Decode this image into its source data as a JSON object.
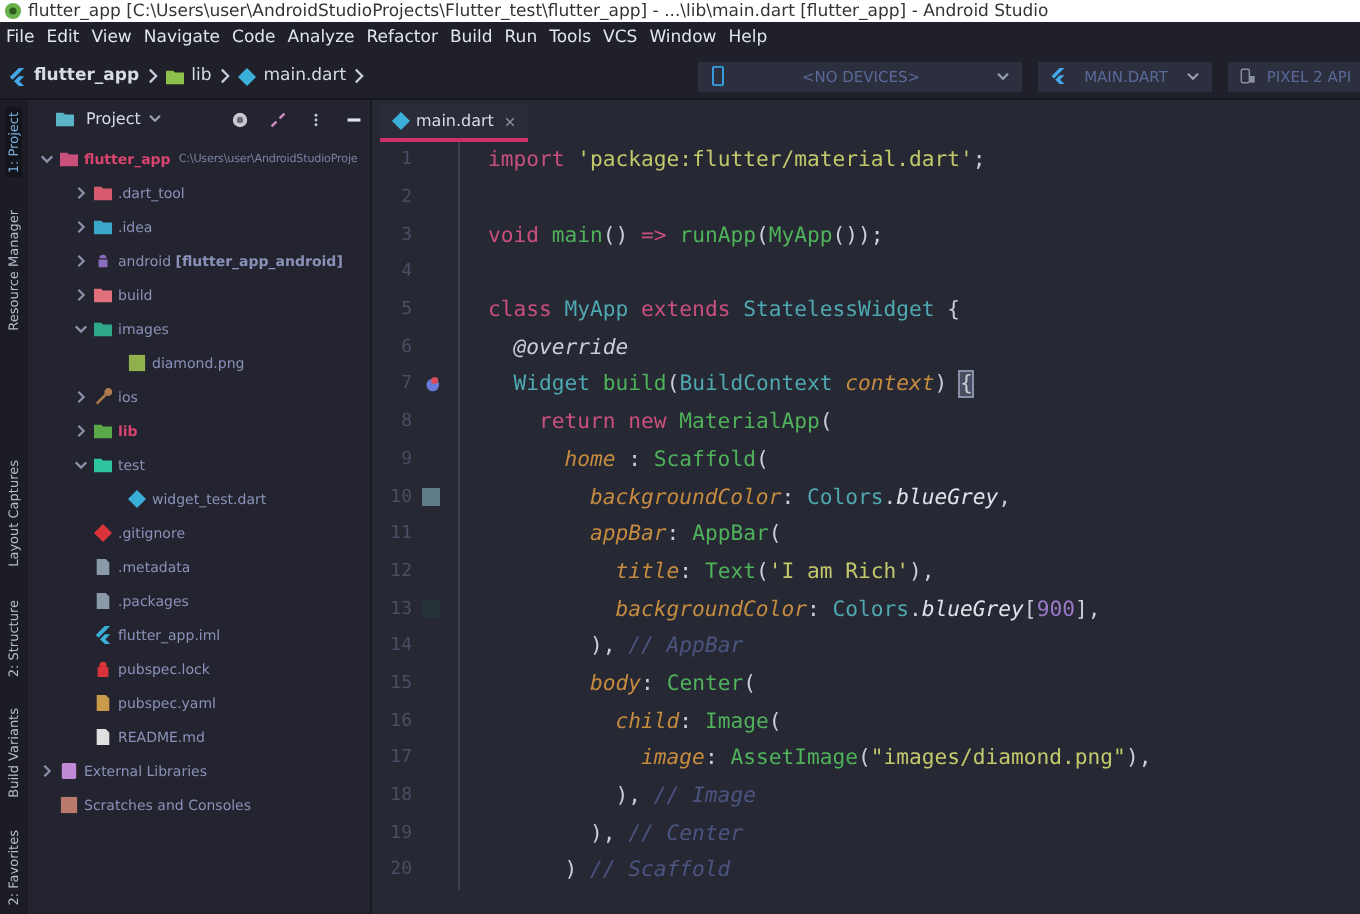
{
  "window": {
    "title": "flutter_app [C:\\Users\\user\\AndroidStudioProjects\\Flutter_test\\flutter_app] - ...\\lib\\main.dart [flutter_app] - Android Studio"
  },
  "menu": [
    "File",
    "Edit",
    "View",
    "Navigate",
    "Code",
    "Analyze",
    "Refactor",
    "Build",
    "Run",
    "Tools",
    "VCS",
    "Window",
    "Help"
  ],
  "breadcrumbs": [
    {
      "label": "flutter_app",
      "kind": "flutter"
    },
    {
      "label": "lib",
      "kind": "folder"
    },
    {
      "label": "main.dart",
      "kind": "dart"
    }
  ],
  "run_toolbar": [
    {
      "label": "<NO DEVICES>",
      "kind": "device"
    },
    {
      "label": "MAIN.DART",
      "kind": "config"
    },
    {
      "label": "PIXEL 2 API",
      "kind": "avd"
    }
  ],
  "tool_strip_top": [
    {
      "label": "1: Project",
      "selected": true
    },
    {
      "label": "Resource Manager",
      "selected": false
    }
  ],
  "tool_strip_bottom": [
    {
      "label": "Layout Captures",
      "selected": false
    },
    {
      "label": "2: Structure",
      "selected": false
    },
    {
      "label": "Build Variants",
      "selected": false
    },
    {
      "label": "2: Favorites",
      "selected": false
    }
  ],
  "project": {
    "title": "Project",
    "tree": [
      {
        "label": "flutter_app",
        "path": "C:\\Users\\user\\AndroidStudioProje",
        "kind": "module",
        "color": "#c8507a",
        "accent": true,
        "expanded": true,
        "children": [
          {
            "label": ".dart_tool",
            "kind": "folder",
            "color": "#d75a6e",
            "expanded": false
          },
          {
            "label": ".idea",
            "kind": "folder",
            "color": "#3aa6c8",
            "expanded": false
          },
          {
            "label": "android **[flutter_app_android]**",
            "kind": "android",
            "color": "#8a6bbd",
            "expanded": false
          },
          {
            "label": "build",
            "kind": "folder",
            "color": "#e0707a",
            "expanded": false
          },
          {
            "label": "images",
            "kind": "folder",
            "color": "#2fa88a",
            "expanded": true,
            "children": [
              {
                "label": "diamond.png",
                "kind": "image",
                "color": "#8fb04a"
              }
            ]
          },
          {
            "label": "ios",
            "kind": "wrench",
            "color": "#b07a4a",
            "expanded": false
          },
          {
            "label": "lib",
            "kind": "folder",
            "color": "#5aa84a",
            "accent": true,
            "expanded": false
          },
          {
            "label": "test",
            "kind": "folder",
            "color": "#2fc4a0",
            "expanded": true,
            "children": [
              {
                "label": "widget_test.dart",
                "kind": "dart",
                "color": "#3ab0d8"
              }
            ]
          },
          {
            "label": ".gitignore",
            "kind": "diamond",
            "color": "#d8343a"
          },
          {
            "label": ".metadata",
            "kind": "file",
            "color": "#8a9aa8"
          },
          {
            "label": ".packages",
            "kind": "file",
            "color": "#8a9aa8"
          },
          {
            "label": "flutter_app.iml",
            "kind": "flutter",
            "color": "#3ab0d8"
          },
          {
            "label": "pubspec.lock",
            "kind": "lock",
            "color": "#d8343a"
          },
          {
            "label": "pubspec.yaml",
            "kind": "file",
            "color": "#c89a4a"
          },
          {
            "label": "README.md",
            "kind": "file",
            "color": "#e0e0e0"
          }
        ]
      },
      {
        "label": "External Libraries",
        "kind": "library",
        "color": "#c08ad8",
        "expanded": false
      },
      {
        "label": "Scratches and Consoles",
        "kind": "scratch",
        "color": "#b87a6a"
      }
    ]
  },
  "editor": {
    "tab": {
      "label": "main.dart",
      "selected": true
    },
    "lines": [
      {
        "number": "1",
        "tokens": [
          {
            "kind": "keyword",
            "text": "import"
          },
          {
            "kind": "string",
            "text": " 'package:flutter/material.dart'"
          },
          {
            "kind": "plain",
            "text": ";"
          }
        ]
      },
      {
        "number": "2"
      },
      {
        "number": "3",
        "tokens": [
          {
            "kind": "keyword",
            "text": "void"
          },
          {
            "kind": "function",
            "text": " main"
          },
          {
            "kind": "plain",
            "text": "() "
          },
          {
            "kind": "keyword",
            "text": "=>"
          },
          {
            "kind": "function",
            "text": " runApp"
          },
          {
            "kind": "plain",
            "text": "("
          },
          {
            "kind": "function",
            "text": "MyApp"
          },
          {
            "kind": "plain",
            "text": "());"
          }
        ]
      },
      {
        "number": "4"
      },
      {
        "number": "5",
        "tokens": [
          {
            "kind": "keyword",
            "text": "class"
          },
          {
            "kind": "type",
            "text": " MyApp"
          },
          {
            "kind": "keyword",
            "text": " extends"
          },
          {
            "kind": "type",
            "text": " StatelessWidget"
          },
          {
            "kind": "plain",
            "text": " {"
          }
        ]
      },
      {
        "number": "6",
        "tokens": [
          {
            "kind": "annotation",
            "text": "  @override"
          }
        ]
      },
      {
        "number": "7",
        "gutter": {
          "kind": "override"
        },
        "tokens": [
          {
            "kind": "type",
            "text": "  Widget"
          },
          {
            "kind": "function",
            "text": " build"
          },
          {
            "kind": "plain",
            "text": "("
          },
          {
            "kind": "type",
            "text": "BuildContext"
          },
          {
            "kind": "param",
            "text": " context"
          },
          {
            "kind": "plain",
            "text": ") "
          },
          {
            "kind": "match",
            "text": "{"
          }
        ]
      },
      {
        "number": "8",
        "tokens": [
          {
            "kind": "keyword",
            "text": "    return"
          },
          {
            "kind": "keyword",
            "text": " new"
          },
          {
            "kind": "function",
            "text": " MaterialApp"
          },
          {
            "kind": "plain",
            "text": "("
          }
        ]
      },
      {
        "number": "9",
        "tokens": [
          {
            "kind": "property",
            "text": "      home"
          },
          {
            "kind": "plain",
            "text": " : "
          },
          {
            "kind": "function",
            "text": "Scaffold"
          },
          {
            "kind": "plain",
            "text": "("
          }
        ]
      },
      {
        "number": "10",
        "gutter": {
          "kind": "swatch",
          "color": "#607d8b"
        },
        "tokens": [
          {
            "kind": "property",
            "text": "        backgroundColor"
          },
          {
            "kind": "plain",
            "text": ": "
          },
          {
            "kind": "type",
            "text": "Colors"
          },
          {
            "kind": "plain",
            "text": "."
          },
          {
            "kind": "italic",
            "text": "blueGrey"
          },
          {
            "kind": "plain",
            "text": ","
          }
        ]
      },
      {
        "number": "11",
        "tokens": [
          {
            "kind": "property",
            "text": "        appBar"
          },
          {
            "kind": "plain",
            "text": ": "
          },
          {
            "kind": "function",
            "text": "AppBar"
          },
          {
            "kind": "plain",
            "text": "("
          }
        ]
      },
      {
        "number": "12",
        "tokens": [
          {
            "kind": "property",
            "text": "          title"
          },
          {
            "kind": "plain",
            "text": ": "
          },
          {
            "kind": "function",
            "text": "Text"
          },
          {
            "kind": "plain",
            "text": "("
          },
          {
            "kind": "string",
            "text": "'I am Rich'"
          },
          {
            "kind": "plain",
            "text": "),"
          }
        ]
      },
      {
        "number": "13",
        "gutter": {
          "kind": "swatch",
          "color": "#263238"
        },
        "tokens": [
          {
            "kind": "property",
            "text": "          backgroundColor"
          },
          {
            "kind": "plain",
            "text": ": "
          },
          {
            "kind": "type",
            "text": "Colors"
          },
          {
            "kind": "plain",
            "text": "."
          },
          {
            "kind": "italic",
            "text": "blueGrey"
          },
          {
            "kind": "plain",
            "text": "["
          },
          {
            "kind": "number",
            "text": "900"
          },
          {
            "kind": "plain",
            "text": "],"
          }
        ]
      },
      {
        "number": "14",
        "tokens": [
          {
            "kind": "plain",
            "text": "        ), "
          },
          {
            "kind": "comment",
            "text": "// AppBar"
          }
        ]
      },
      {
        "number": "15",
        "tokens": [
          {
            "kind": "property",
            "text": "        body"
          },
          {
            "kind": "plain",
            "text": ": "
          },
          {
            "kind": "function",
            "text": "Center"
          },
          {
            "kind": "plain",
            "text": "("
          }
        ]
      },
      {
        "number": "16",
        "tokens": [
          {
            "kind": "property",
            "text": "          child"
          },
          {
            "kind": "plain",
            "text": ": "
          },
          {
            "kind": "function",
            "text": "Image"
          },
          {
            "kind": "plain",
            "text": "("
          }
        ]
      },
      {
        "number": "17",
        "tokens": [
          {
            "kind": "property",
            "text": "            image"
          },
          {
            "kind": "plain",
            "text": ": "
          },
          {
            "kind": "function",
            "text": "AssetImage"
          },
          {
            "kind": "plain",
            "text": "("
          },
          {
            "kind": "string",
            "text": "\"images/diamond.png\""
          },
          {
            "kind": "plain",
            "text": "),"
          }
        ]
      },
      {
        "number": "18",
        "tokens": [
          {
            "kind": "plain",
            "text": "          ), "
          },
          {
            "kind": "comment",
            "text": "// Image"
          }
        ]
      },
      {
        "number": "19",
        "tokens": [
          {
            "kind": "plain",
            "text": "        ), "
          },
          {
            "kind": "comment",
            "text": "// Center"
          }
        ]
      },
      {
        "number": "20",
        "tokens": [
          {
            "kind": "plain",
            "text": "      ) "
          },
          {
            "kind": "comment",
            "text": "// Scaffold"
          }
        ]
      }
    ]
  }
}
